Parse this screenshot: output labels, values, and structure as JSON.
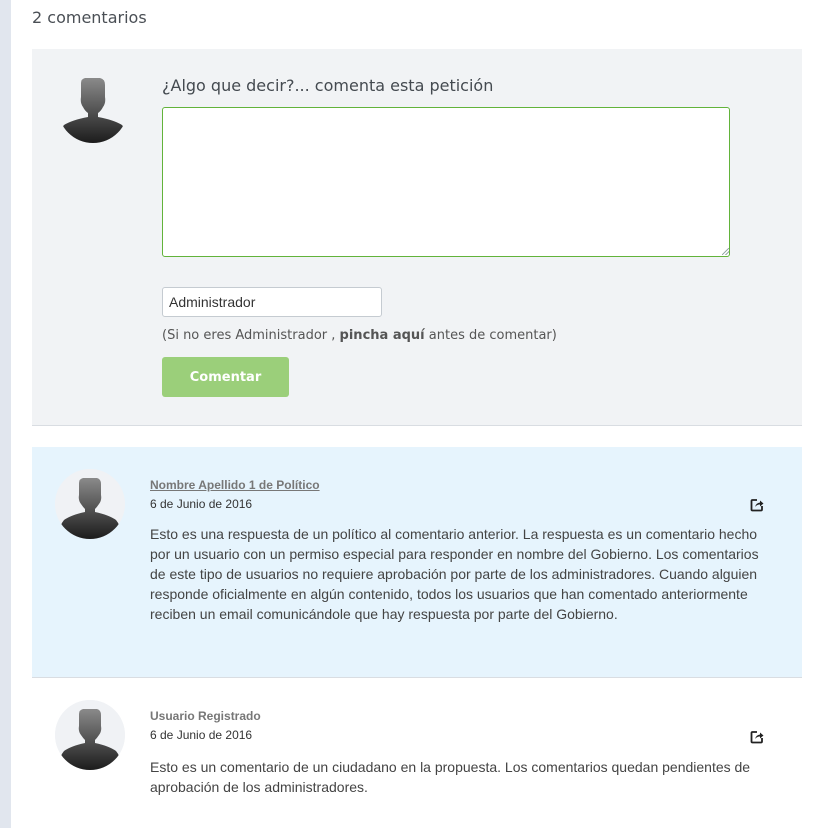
{
  "comments_count": "2 comentarios",
  "form": {
    "title": "¿Algo que decir?... comenta esta petición",
    "comment_value": "",
    "name_value": "Administrador",
    "hint_prefix": "(Si no eres Administrador ,",
    "hint_link": "pincha aquí",
    "hint_suffix": "antes de comentar)",
    "submit_label": "Comentar",
    "avatar_icon": "user-silhouette-icon"
  },
  "comments": [
    {
      "author": "Nombre Apellido 1 de Político",
      "date": "6 de Junio de 2016",
      "text": "Esto es una respuesta de un político al comentario anterior. La respuesta es un comentario hecho por un usuario con un permiso especial para responder en nombre del Gobierno. Los comentarios de este tipo de usuarios no requiere aprobación por parte de los administradores. Cuando alguien responde oficialmente en algún contenido, todos los usuarios que han comentado anteriormente reciben un email comunicándole que hay respuesta por parte del Gobierno.",
      "share_icon": "share-icon"
    },
    {
      "author": "Usuario Registrado",
      "date": "6 de Junio de 2016",
      "text": "Esto es un comentario de un ciudadano en la propuesta. Los comentarios quedan pendientes de aprobación de los administradores.",
      "share_icon": "share-icon"
    }
  ],
  "colors": {
    "form_bg": "#f1f3f5",
    "textarea_border": "#62b33a",
    "button_bg": "#9bcf7a",
    "official_bg": "#e6f4fd"
  }
}
